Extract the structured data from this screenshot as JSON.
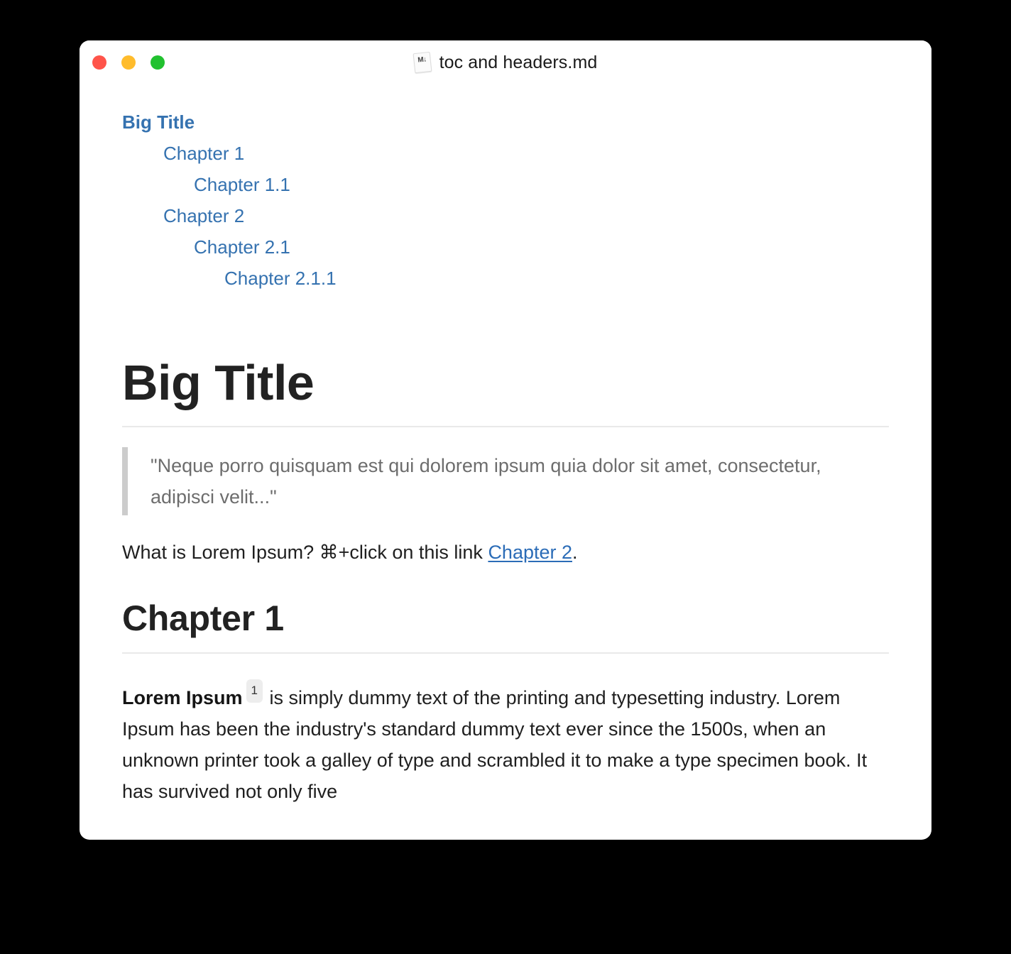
{
  "window": {
    "title": "toc and headers.md",
    "file_icon": "markdown-file-icon",
    "file_icon_glyph": "M↓",
    "traffic_lights": [
      {
        "name": "close",
        "color": "#ff544a"
      },
      {
        "name": "minimize",
        "color": "#ffbc2c"
      },
      {
        "name": "zoom",
        "color": "#21c12f"
      }
    ]
  },
  "colors": {
    "link": "#3572b0",
    "body_link": "#2b6cb7",
    "heading": "#222222",
    "body_text": "#1f1f1f",
    "quote_text": "#6d6d6d",
    "quote_bar": "#cccccc",
    "rule": "#e9e9e9",
    "footnote_badge_bg": "#ededed",
    "page_bg": "#ffffff",
    "desktop_bg": "#000000"
  },
  "toc": {
    "items": [
      {
        "label": "Big Title",
        "level": 1
      },
      {
        "label": "Chapter 1",
        "level": 2
      },
      {
        "label": "Chapter 1.1",
        "level": 3
      },
      {
        "label": "Chapter 2",
        "level": 2
      },
      {
        "label": "Chapter 2.1",
        "level": 3
      },
      {
        "label": "Chapter 2.1.1",
        "level": 4
      }
    ]
  },
  "document": {
    "h1": "Big Title",
    "blockquote": "\"Neque porro quisquam est qui dolorem ipsum quia dolor sit amet, consectetur, adipisci velit...\"",
    "intro_paragraph": {
      "before_link": "What is Lorem Ipsum? ⌘+click on this link ",
      "link_text": "Chapter 2",
      "after_link": "."
    },
    "h2": "Chapter 1",
    "body_paragraph": {
      "strong": "Lorem Ipsum",
      "footnote_marker": "1",
      "rest": " is simply dummy text of the printing and typesetting industry. Lorem Ipsum has been the industry's standard dummy text ever since the 1500s, when an unknown printer took a galley of type and scrambled it to make a type specimen book. It has survived not only five"
    }
  }
}
